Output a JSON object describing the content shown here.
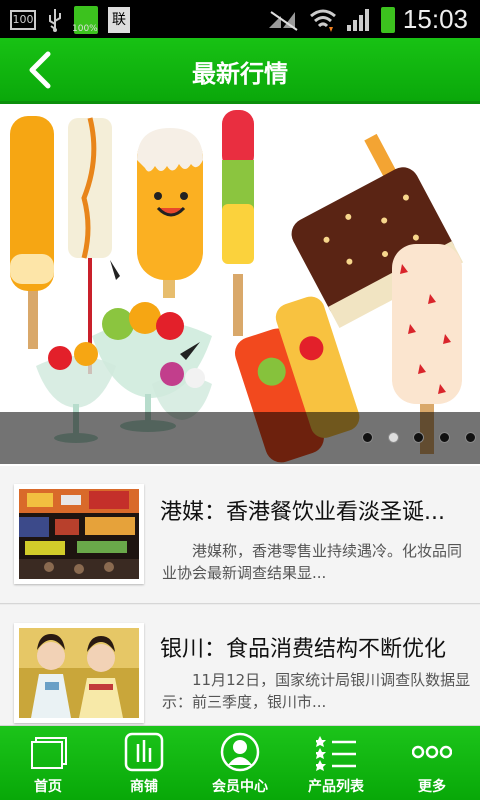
{
  "status_bar": {
    "left_icons": [
      "notification-box-icon",
      "usb-icon",
      "battery-icon",
      "sim-icon"
    ],
    "left_box_text": "100",
    "battery_text": "100%",
    "sim_text": "联",
    "time": "15:03"
  },
  "header": {
    "title": "最新行情"
  },
  "banner": {
    "slide_count": 5,
    "active_index": 1
  },
  "news": [
    {
      "title": "港媒：香港餐饮业看淡圣诞...",
      "summary": "港媒称，香港零售业持续遇冷。化妆品同业协会最新调查结果显..."
    },
    {
      "title": "银川：食品消费结构不断优化",
      "summary": "11月12日，国家统计局银川调查队数据显示：前三季度，银川市..."
    }
  ],
  "tabs": [
    {
      "label": "首页",
      "icon": "home-icon"
    },
    {
      "label": "商铺",
      "icon": "shop-icon"
    },
    {
      "label": "会员中心",
      "icon": "member-icon"
    },
    {
      "label": "产品列表",
      "icon": "list-icon"
    },
    {
      "label": "更多",
      "icon": "more-icon"
    }
  ],
  "colors": {
    "brand_green": "#10b510",
    "status_bar": "#000000"
  }
}
